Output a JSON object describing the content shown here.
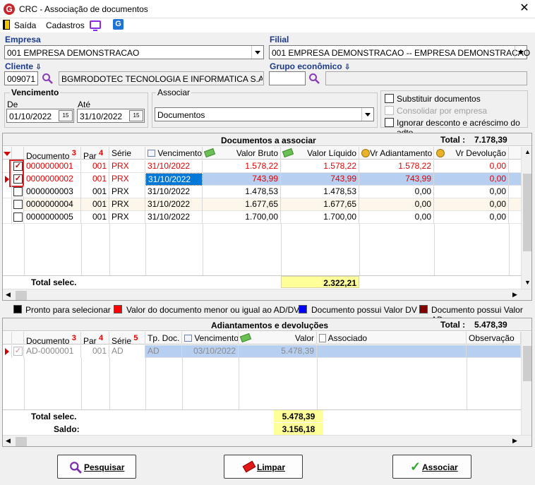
{
  "window": {
    "title": "CRC - Associação de documentos",
    "close": "✕"
  },
  "menu": {
    "exit": "Saída",
    "registers": "Cadastros"
  },
  "empresa": {
    "label": "Empresa",
    "value": "001 EMPRESA DEMONSTRACAO"
  },
  "filial": {
    "label": "Filial",
    "value": "001 EMPRESA DEMONSTRACAO -- EMPRESA DEMONSTRACAO"
  },
  "cliente": {
    "label": "Cliente",
    "code": "009071",
    "name": "BGMRODOTEC TECNOLOGIA E INFORMATICA S.A. - CNPJ",
    "sort_icon": "⇩"
  },
  "grupo": {
    "label": "Grupo econômico",
    "code": "",
    "name": "",
    "sort_icon": "⇩"
  },
  "vencimento": {
    "title": "Vencimento",
    "from_label": "De",
    "from": "01/10/2022",
    "to_label": "Até",
    "to": "31/10/2022",
    "cal": "15"
  },
  "associar": {
    "title": "Associar",
    "value": "Documentos"
  },
  "options": [
    {
      "label": "Substituir documentos",
      "checked": false,
      "disabled": false
    },
    {
      "label": "Consolidar por empresa",
      "checked": false,
      "disabled": true
    },
    {
      "label": "Ignorar desconto e acréscimo do adto",
      "checked": false,
      "disabled": false
    }
  ],
  "docs": {
    "title": "Documentos a associar",
    "total_label": "Total :",
    "total_value": "7.178,39",
    "columns": {
      "documento": "Documento",
      "documento_sort": "3",
      "par": "Par",
      "par_sort": "4",
      "serie": "Série",
      "vencimento": "Vencimento",
      "valor_bruto": "Valor Bruto",
      "valor_liquido": "Valor Líquido",
      "vr_adiantamento": "Vr Adiantamento",
      "vr_devolucao": "Vr Devolução"
    },
    "rows": [
      {
        "documento": "0000000001",
        "par": "001",
        "serie": "PRX",
        "vencimento": "31/10/2022",
        "bruto": "1.578,22",
        "liquido": "1.578,22",
        "adiant": "1.578,22",
        "devol": "0,00"
      },
      {
        "documento": "0000000002",
        "par": "001",
        "serie": "PRX",
        "vencimento": "31/10/2022",
        "bruto": "743,99",
        "liquido": "743,99",
        "adiant": "743,99",
        "devol": "0,00"
      },
      {
        "documento": "0000000003",
        "par": "001",
        "serie": "PRX",
        "vencimento": "31/10/2022",
        "bruto": "1.478,53",
        "liquido": "1.478,53",
        "adiant": "0,00",
        "devol": "0,00"
      },
      {
        "documento": "0000000004",
        "par": "001",
        "serie": "PRX",
        "vencimento": "31/10/2022",
        "bruto": "1.677,65",
        "liquido": "1.677,65",
        "adiant": "0,00",
        "devol": "0,00"
      },
      {
        "documento": "0000000005",
        "par": "001",
        "serie": "PRX",
        "vencimento": "31/10/2022",
        "bruto": "1.700,00",
        "liquido": "1.700,00",
        "adiant": "0,00",
        "devol": "0,00"
      }
    ],
    "footer_label": "Total selec.",
    "footer_value": "2.322,21"
  },
  "legend": [
    {
      "label": "Pronto para selecionar",
      "color": "#000000"
    },
    {
      "label": "Valor do documento menor ou igual ao AD/DV",
      "color": "#ff0000"
    },
    {
      "label": "Documento possui Valor DV",
      "color": "#0000ff"
    },
    {
      "label": "Documento possui Valor AD",
      "color": "#800000"
    }
  ],
  "adto": {
    "title": "Adiantamentos e devoluções",
    "total_label": "Total :",
    "total_value": "5.478,39",
    "columns": {
      "documento": "Documento",
      "documento_sort": "3",
      "par": "Par",
      "par_sort": "4",
      "serie": "Série",
      "serie_sort": "5",
      "tpdoc": "Tp. Doc.",
      "vencimento": "Vencimento",
      "valor": "Valor",
      "associado": "Associado",
      "observacao": "Observação"
    },
    "rows": [
      {
        "documento": "AD-0000001",
        "par": "001",
        "serie": "AD",
        "tpdoc": "AD",
        "vencimento": "03/10/2022",
        "valor": "5.478,39",
        "associado": "",
        "observacao": ""
      }
    ],
    "footer_total_label": "Total selec.",
    "footer_total_value": "5.478,39",
    "footer_saldo_label": "Saldo:",
    "footer_saldo_value": "3.156,18"
  },
  "buttons": {
    "search": "Pesquisar",
    "clear": "Limpar",
    "associate": "Associar"
  },
  "colors": {
    "accent": "#1b3a8c",
    "selection": "#b7cff0",
    "highlight": "#ffff99",
    "alert": "#e00000"
  }
}
